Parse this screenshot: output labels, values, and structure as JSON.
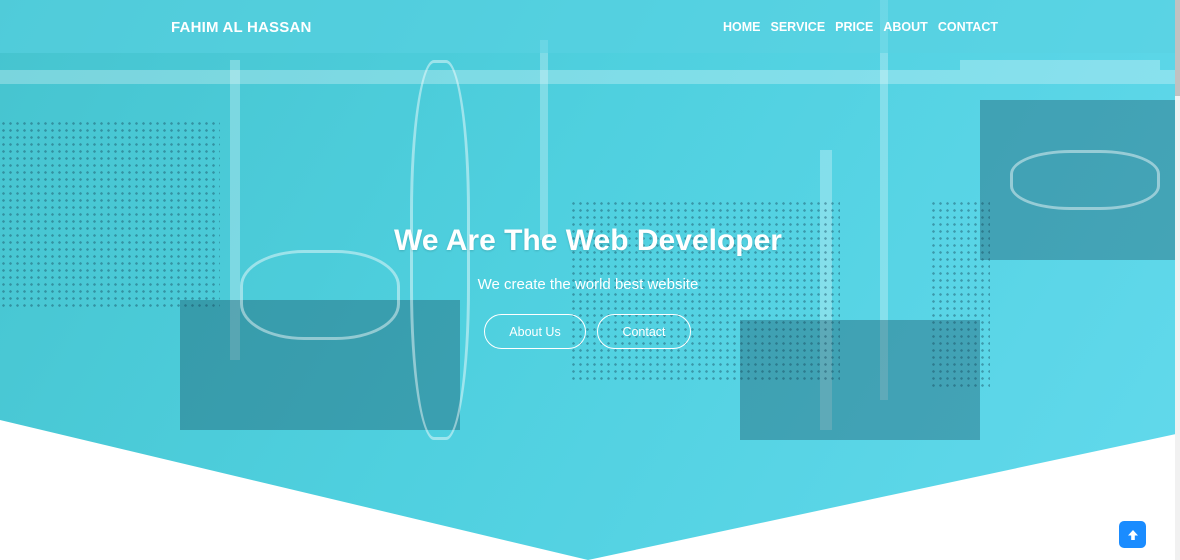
{
  "brand": "FAHIM AL HASSAN",
  "nav": {
    "items": [
      {
        "label": "HOME"
      },
      {
        "label": "SERVICE"
      },
      {
        "label": "PRICE"
      },
      {
        "label": "ABOUT"
      },
      {
        "label": "CONTACT"
      }
    ]
  },
  "hero": {
    "title": "We Are The Web Developer",
    "subtitle": "We create the world best website",
    "about_button": "About Us",
    "contact_button": "Contact"
  },
  "icons": {
    "to_top": "arrow-up-icon"
  },
  "colors": {
    "overlay": "#4fd0df",
    "accent_button": "#1a8cff",
    "text": "#ffffff"
  }
}
